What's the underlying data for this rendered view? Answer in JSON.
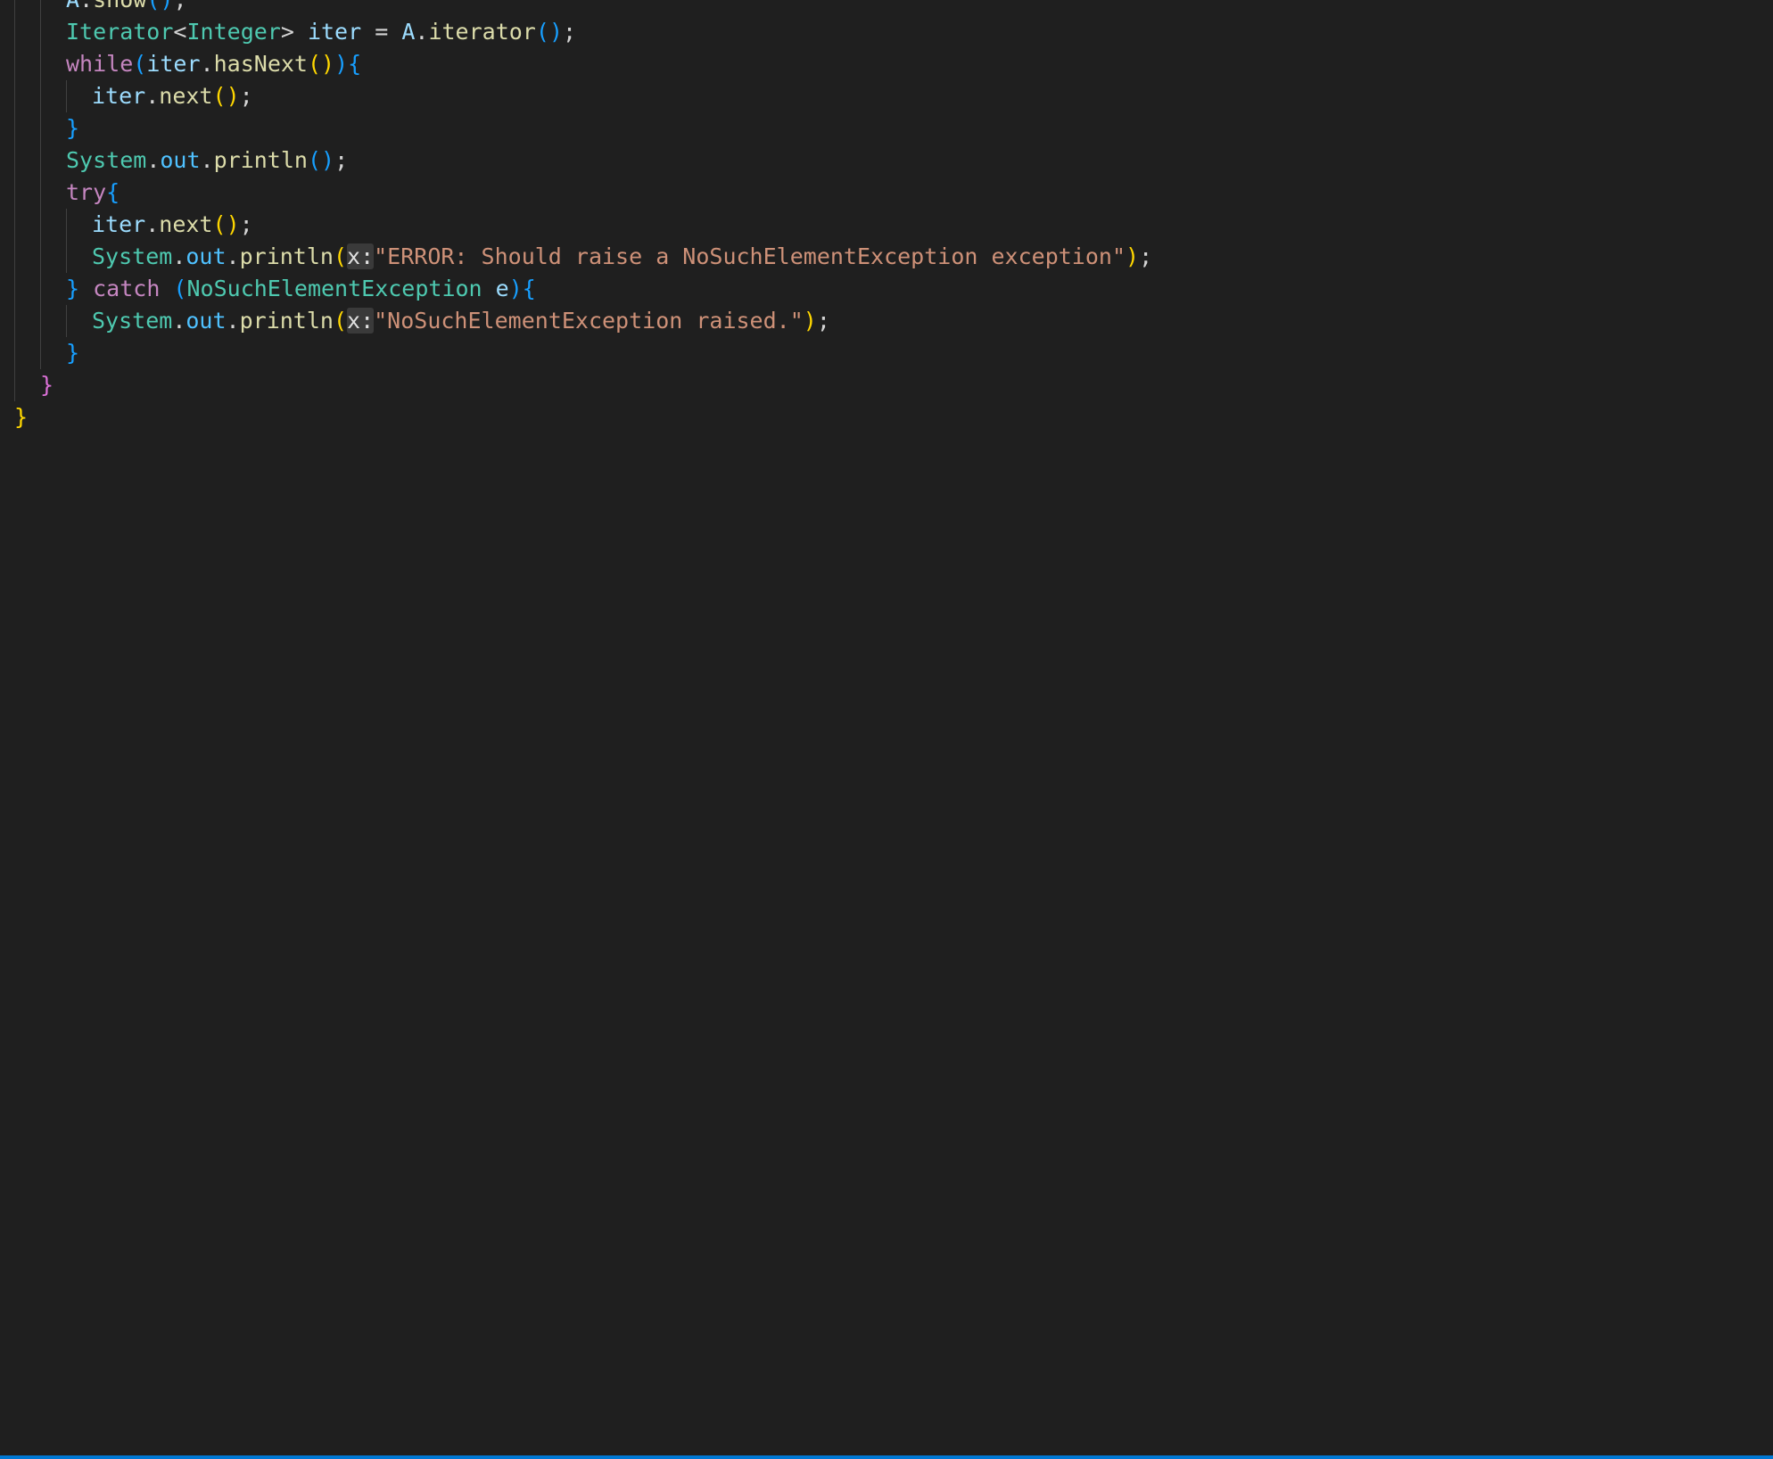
{
  "editor": {
    "language": "java",
    "accent_color": "#0078d4",
    "background_color": "#1f1f1f",
    "lines": [
      {
        "indent": 2,
        "tokens": [
          {
            "t": "A",
            "c": "var"
          },
          {
            "t": ".",
            "c": "op"
          },
          {
            "t": "show",
            "c": "fn"
          },
          {
            "t": "(",
            "c": "p3"
          },
          {
            "t": ")",
            "c": "p3"
          },
          {
            "t": ";",
            "c": "op"
          }
        ]
      },
      {
        "indent": 2,
        "tokens": [
          {
            "t": "Iterator",
            "c": "type"
          },
          {
            "t": "<",
            "c": "op"
          },
          {
            "t": "Integer",
            "c": "type"
          },
          {
            "t": "> ",
            "c": "op"
          },
          {
            "t": "iter",
            "c": "var"
          },
          {
            "t": " = ",
            "c": "op"
          },
          {
            "t": "A",
            "c": "var"
          },
          {
            "t": ".",
            "c": "op"
          },
          {
            "t": "iterator",
            "c": "fn"
          },
          {
            "t": "(",
            "c": "p3"
          },
          {
            "t": ")",
            "c": "p3"
          },
          {
            "t": ";",
            "c": "op"
          }
        ]
      },
      {
        "indent": 2,
        "tokens": [
          {
            "t": "while",
            "c": "kw"
          },
          {
            "t": "(",
            "c": "p3"
          },
          {
            "t": "iter",
            "c": "var"
          },
          {
            "t": ".",
            "c": "op"
          },
          {
            "t": "hasNext",
            "c": "fn"
          },
          {
            "t": "(",
            "c": "p1"
          },
          {
            "t": ")",
            "c": "p1"
          },
          {
            "t": ")",
            "c": "p3"
          },
          {
            "t": "{",
            "c": "p3"
          }
        ]
      },
      {
        "indent": 3,
        "tokens": [
          {
            "t": "iter",
            "c": "var"
          },
          {
            "t": ".",
            "c": "op"
          },
          {
            "t": "next",
            "c": "fn"
          },
          {
            "t": "(",
            "c": "p1"
          },
          {
            "t": ")",
            "c": "p1"
          },
          {
            "t": ";",
            "c": "op"
          }
        ]
      },
      {
        "indent": 2,
        "tokens": [
          {
            "t": "}",
            "c": "p3"
          }
        ]
      },
      {
        "indent": 2,
        "tokens": [
          {
            "t": "System",
            "c": "type"
          },
          {
            "t": ".",
            "c": "op"
          },
          {
            "t": "out",
            "c": "prop"
          },
          {
            "t": ".",
            "c": "op"
          },
          {
            "t": "println",
            "c": "fn"
          },
          {
            "t": "(",
            "c": "p3"
          },
          {
            "t": ")",
            "c": "p3"
          },
          {
            "t": ";",
            "c": "op"
          }
        ]
      },
      {
        "indent": 2,
        "tokens": [
          {
            "t": "try",
            "c": "kw"
          },
          {
            "t": "{",
            "c": "p3"
          }
        ]
      },
      {
        "indent": 3,
        "tokens": [
          {
            "t": "iter",
            "c": "var"
          },
          {
            "t": ".",
            "c": "op"
          },
          {
            "t": "next",
            "c": "fn"
          },
          {
            "t": "(",
            "c": "p1"
          },
          {
            "t": ")",
            "c": "p1"
          },
          {
            "t": ";",
            "c": "op"
          }
        ]
      },
      {
        "indent": 3,
        "tokens": [
          {
            "t": "System",
            "c": "type"
          },
          {
            "t": ".",
            "c": "op"
          },
          {
            "t": "out",
            "c": "prop"
          },
          {
            "t": ".",
            "c": "op"
          },
          {
            "t": "println",
            "c": "fn"
          },
          {
            "t": "(",
            "c": "p1"
          },
          {
            "t": "x:",
            "c": "hint"
          },
          {
            "t": "\"ERROR: Should raise a NoSuchElementException exception\"",
            "c": "str"
          },
          {
            "t": ")",
            "c": "p1"
          },
          {
            "t": ";",
            "c": "op"
          }
        ]
      },
      {
        "indent": 2,
        "tokens": [
          {
            "t": "}",
            "c": "p3"
          },
          {
            "t": " catch ",
            "c": "kw"
          },
          {
            "t": "(",
            "c": "p3"
          },
          {
            "t": "NoSuchElementException",
            "c": "type"
          },
          {
            "t": " e",
            "c": "var"
          },
          {
            "t": ")",
            "c": "p3"
          },
          {
            "t": "{",
            "c": "p3"
          }
        ]
      },
      {
        "indent": 3,
        "tokens": [
          {
            "t": "System",
            "c": "type"
          },
          {
            "t": ".",
            "c": "op"
          },
          {
            "t": "out",
            "c": "prop"
          },
          {
            "t": ".",
            "c": "op"
          },
          {
            "t": "println",
            "c": "fn"
          },
          {
            "t": "(",
            "c": "p1"
          },
          {
            "t": "x:",
            "c": "hint"
          },
          {
            "t": "\"NoSuchElementException raised.\"",
            "c": "str"
          },
          {
            "t": ")",
            "c": "p1"
          },
          {
            "t": ";",
            "c": "op"
          }
        ]
      },
      {
        "indent": 2,
        "tokens": [
          {
            "t": "}",
            "c": "p3"
          }
        ]
      },
      {
        "indent": 1,
        "tokens": [
          {
            "t": "}",
            "c": "p2"
          }
        ]
      },
      {
        "indent": 0,
        "tokens": [
          {
            "t": "}",
            "c": "p1"
          }
        ]
      }
    ]
  }
}
